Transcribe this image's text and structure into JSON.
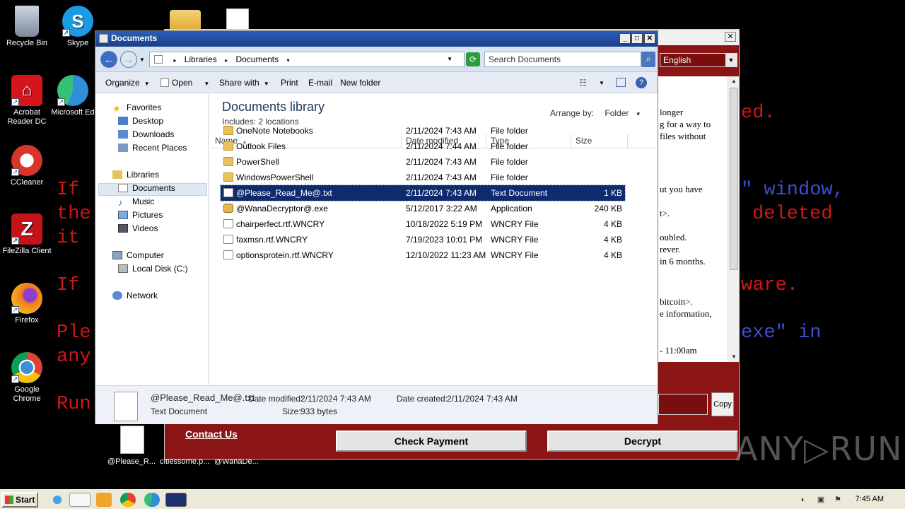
{
  "ransom_bg": {
    "lines": [
      {
        "text": "If",
        "blue": false
      },
      {
        "text": "the",
        "blue": false
      },
      {
        "text": "it",
        "blue": false
      },
      {
        "text": "If",
        "blue": false
      },
      {
        "text": "Ple",
        "blue": false
      },
      {
        "text": "any",
        "blue": false
      },
      {
        "text": "Run",
        "blue": false
      },
      {
        "text": "ed.",
        "blue": false
      },
      {
        "text": "\" window,",
        "blue": true
      },
      {
        "text": "deleted",
        "blue": false
      },
      {
        "text": "ware.",
        "blue": false
      },
      {
        "text": "exe\" in",
        "blue": true
      }
    ]
  },
  "ransom_window": {
    "language": "English",
    "text_lines": [
      "longer",
      "g for a way to",
      "files without",
      "ut you have",
      "t>.",
      "oubled.",
      "rever.",
      "in 6 months.",
      "bitcoin>.",
      "e information,",
      "- 11:00am"
    ],
    "copy_label": "Copy",
    "contact_label": "Contact Us",
    "check_payment_label": "Check Payment",
    "decrypt_label": "Decrypt"
  },
  "desktop_icons": [
    {
      "label": "Recycle Bin",
      "icon": "recycle-bin-icon",
      "color": "#9aa8b8"
    },
    {
      "label": "Acrobat Reader DC",
      "icon": "acrobat-icon",
      "color": "#d5141c"
    },
    {
      "label": "CCleaner",
      "icon": "ccleaner-icon",
      "color": "#d9342a"
    },
    {
      "label": "FileZilla Client",
      "icon": "filezilla-icon",
      "color": "#c4141a"
    },
    {
      "label": "Firefox",
      "icon": "firefox-icon",
      "color": "#f0781e"
    },
    {
      "label": "Google Chrome",
      "icon": "chrome-icon",
      "color": "#3b8ed8"
    },
    {
      "label": "Skype",
      "icon": "skype-icon",
      "color": "#1b9be3"
    },
    {
      "label": "Microsoft Ed",
      "icon": "edge-icon",
      "color": "#2f8fd8"
    }
  ],
  "desktop_bottom_labels": [
    "@Please_R...",
    "citiessome.p...",
    "@WanaDe..."
  ],
  "explorer": {
    "title": "Documents",
    "breadcrumb": [
      "Libraries",
      "Documents"
    ],
    "search_placeholder": "Search Documents",
    "toolbar": {
      "organize": "Organize",
      "open": "Open",
      "share_with": "Share with",
      "print": "Print",
      "email": "E-mail",
      "new_folder": "New folder"
    },
    "nav": {
      "favorites": "Favorites",
      "desktop": "Desktop",
      "downloads": "Downloads",
      "recent_places": "Recent Places",
      "libraries": "Libraries",
      "documents": "Documents",
      "music": "Music",
      "pictures": "Pictures",
      "videos": "Videos",
      "computer": "Computer",
      "local_disk": "Local Disk (C:)",
      "network": "Network"
    },
    "library_title": "Documents library",
    "library_sub": "Includes:  2 locations",
    "arrange_by_label": "Arrange by:",
    "arrange_by_value": "Folder",
    "columns": {
      "name": "Name",
      "date": "Date modified",
      "type": "Type",
      "size": "Size"
    },
    "files": [
      {
        "name": "OneNote Notebooks",
        "date": "2/11/2024 7:43 AM",
        "type": "File folder",
        "size": "",
        "kind": "folder"
      },
      {
        "name": "Outlook Files",
        "date": "2/11/2024 7:44 AM",
        "type": "File folder",
        "size": "",
        "kind": "folder"
      },
      {
        "name": "PowerShell",
        "date": "2/11/2024 7:43 AM",
        "type": "File folder",
        "size": "",
        "kind": "folder"
      },
      {
        "name": "WindowsPowerShell",
        "date": "2/11/2024 7:43 AM",
        "type": "File folder",
        "size": "",
        "kind": "folder"
      },
      {
        "name": "@Please_Read_Me@.txt",
        "date": "2/11/2024 7:43 AM",
        "type": "Text Document",
        "size": "1 KB",
        "kind": "doc",
        "selected": true
      },
      {
        "name": "@WanaDecryptor@.exe",
        "date": "5/12/2017 3:22 AM",
        "type": "Application",
        "size": "240 KB",
        "kind": "app"
      },
      {
        "name": "chairperfect.rtf.WNCRY",
        "date": "10/18/2022 5:19 PM",
        "type": "WNCRY File",
        "size": "4 KB",
        "kind": "doc"
      },
      {
        "name": "faxmsn.rtf.WNCRY",
        "date": "7/19/2023 10:01 PM",
        "type": "WNCRY File",
        "size": "4 KB",
        "kind": "doc"
      },
      {
        "name": "optionsprotein.rtf.WNCRY",
        "date": "12/10/2022 11:23 AM",
        "type": "WNCRY File",
        "size": "4 KB",
        "kind": "doc"
      }
    ],
    "details": {
      "filename": "@Please_Read_Me@.txt",
      "filetype": "Text Document",
      "modified_label": "Date modified:",
      "modified": "2/11/2024 7:43 AM",
      "created_label": "Date created:",
      "created": "2/11/2024 7:43 AM",
      "size_label": "Size:",
      "size": "933 bytes"
    }
  },
  "taskbar": {
    "start_label": "Start",
    "clock": "7:45 AM"
  },
  "watermark": "ANY▷RUN"
}
